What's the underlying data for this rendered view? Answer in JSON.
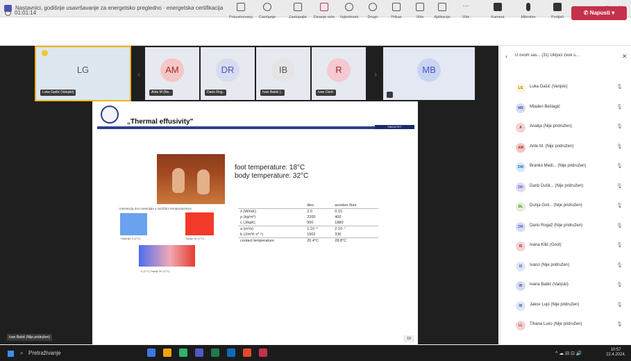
{
  "window": {
    "title": "Nastavnici, godišnje usavršavanje za energetsko pregledno · energetska certifikacija",
    "controls": [
      "...",
      "–",
      "□",
      "✕"
    ]
  },
  "toolbar": {
    "timer": "01:01:14",
    "buttons": [
      {
        "label": "Prisustvovanja",
        "icon": "attendance-icon"
      },
      {
        "label": "Čavrljanje",
        "icon": "chat-icon"
      },
      {
        "label": "Zastupajte",
        "icon": "people-icon"
      },
      {
        "label": "Dizanje ruke",
        "icon": "raise-hand-icon"
      },
      {
        "label": "Izglednosti",
        "icon": "reactions-icon"
      },
      {
        "label": "Drugo",
        "icon": "rooms-icon"
      },
      {
        "label": "Prikaz",
        "icon": "view-icon"
      },
      {
        "label": "Više",
        "icon": "apps-icon"
      },
      {
        "label": "Aplikacije",
        "icon": "apps-grid-icon"
      },
      {
        "label": "Više",
        "icon": "more-icon"
      },
      {
        "label": "Kamera",
        "icon": "camera-icon"
      },
      {
        "label": "Mikrofon",
        "icon": "mic-icon"
      },
      {
        "label": "Podijeli",
        "icon": "share-icon"
      }
    ],
    "leave_label": "Napusti"
  },
  "stage": {
    "tiles": [
      {
        "initials": "LG",
        "name": "Luka Gašić (Vanjski)",
        "color": "#e2e9f3",
        "text": "#555555"
      },
      {
        "initials": "AM",
        "name": "Ante M (Ne..",
        "color": "#f4c6c6",
        "text": "#a4262c"
      },
      {
        "initials": "DR",
        "name": "Dario Rog..",
        "color": "#d8dcf0",
        "text": "#4b53bc"
      },
      {
        "initials": "IB",
        "name": "Ivan Babić (..",
        "color": "#e5e5e5",
        "text": "#555555"
      },
      {
        "initials": "R",
        "name": "Ivan Ozrić",
        "color": "#f4c9d2",
        "text": "#a4262c"
      },
      {
        "initials": "MB",
        "name": "",
        "color": "#c8d4f2",
        "text": "#4b53bc"
      }
    ],
    "self_name": "Ivan Babić (Nije pridružen)",
    "page_number": "19"
  },
  "slide": {
    "title": "„Thermal effusivity\"",
    "band_text": "FAKULTET",
    "temperatures": [
      "foot temperature: 18°C",
      "body temperature: 32°C"
    ],
    "diagram_caption": "Interakcija dva materijala s različitim temperaturama",
    "cold_label": "Hladnije 0 (1°C)",
    "hot_label": "Toplije 40 (1°C)",
    "gradient_label": "0 (1°C)   Toplije 40 (1°C)",
    "table": {
      "headers": [
        "",
        "tiles",
        "wooden floor"
      ],
      "rows": [
        [
          "λ (W/mK)",
          "2.0",
          "0.15"
        ],
        [
          "ρ (kg/m³)",
          "2200",
          "400"
        ],
        [
          "c (J/kgK)",
          "900",
          "1880"
        ]
      ],
      "rows2": [
        [
          "a (m²/s)",
          "1.10⁻⁶",
          "2.10⁻⁷"
        ],
        [
          "b (J/m²K s⁰·⁵)",
          "1902",
          "336"
        ]
      ],
      "rows3": [
        [
          "contact temperature",
          "20.4°C",
          "28.8°C"
        ]
      ]
    }
  },
  "panel": {
    "title": "U ovom sas...  (31)  Ukljuci zvuk s...",
    "participants": [
      {
        "initials": "LG",
        "name": "Luka Gašić (Vanjski)",
        "bg": "#fff4d4",
        "fg": "#8a6d00"
      },
      {
        "initials": "MB",
        "name": "Mladen Bešlagić",
        "bg": "#d8dcf0",
        "fg": "#4b53bc"
      },
      {
        "initials": "A",
        "name": "Analija (Nije pridružen)",
        "bg": "#f4d3d3",
        "fg": "#a4262c"
      },
      {
        "initials": "AM",
        "name": "Ante M. (Nije pridružen)",
        "bg": "#f4c6c6",
        "fg": "#a4262c"
      },
      {
        "initials": "DM",
        "name": "Branko Medi... (Nije pridružen)",
        "bg": "#d8e8f6",
        "fg": "#0f6cbd"
      },
      {
        "initials": "DD",
        "name": "Dario Dušk... (Nije pridružen)",
        "bg": "#dedcf2",
        "fg": "#4b53bc"
      },
      {
        "initials": "DL",
        "name": "Dunja Goli... (Nije pridružen)",
        "bg": "#e3f0d8",
        "fg": "#498205"
      },
      {
        "initials": "DR",
        "name": "Dario Rogaž (Nije pridružen)",
        "bg": "#d8dcf0",
        "fg": "#4b53bc"
      },
      {
        "initials": "IS",
        "name": "Ivana Kilić (Gost)",
        "bg": "#f4d3d3",
        "fg": "#a4262c"
      },
      {
        "initials": "IS",
        "name": "Ivano (Nije pridružen)",
        "bg": "#dfe6f7",
        "fg": "#4b53bc"
      },
      {
        "initials": "IB",
        "name": "Ivana Babić (Vanjski)",
        "bg": "#d8dcf0",
        "fg": "#4b53bc"
      },
      {
        "initials": "IB",
        "name": "Jakov Lujo (Nije pridružen)",
        "bg": "#dfe6f7",
        "fg": "#4b53bc"
      },
      {
        "initials": "LL",
        "name": "Tihana Luko (Nije pridružen)",
        "bg": "#f4d3d3",
        "fg": "#a4262c"
      }
    ]
  },
  "taskbar": {
    "search_placeholder": "Pretraživanje",
    "apps": [
      "#3b78e7",
      "#f0a30a",
      "#2fb36e",
      "#5059c9",
      "#1f7a4d",
      "#0f6cbd",
      "#e34b2c",
      "#c4314b"
    ],
    "tray": "^  ☁  ⊟  ⊡  🔊",
    "time": "10:57",
    "date": "22.4.2024."
  }
}
